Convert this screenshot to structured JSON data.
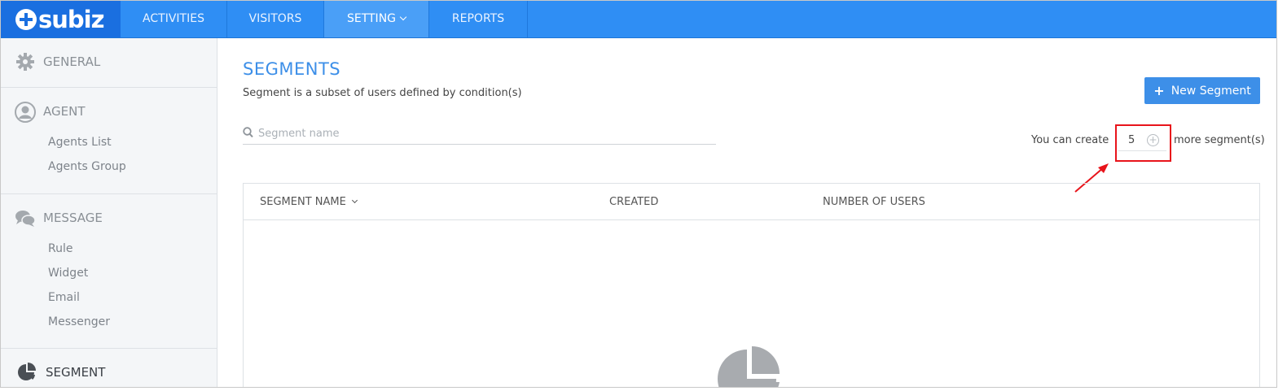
{
  "app": {
    "logo": "subiz"
  },
  "nav": {
    "items": [
      {
        "label": "ACTIVITIES"
      },
      {
        "label": "VISITORS"
      },
      {
        "label": "SETTING"
      },
      {
        "label": "REPORTS"
      }
    ]
  },
  "sidebar": {
    "general": {
      "label": "GENERAL"
    },
    "agent": {
      "label": "AGENT",
      "items": [
        {
          "label": "Agents List"
        },
        {
          "label": "Agents Group"
        }
      ]
    },
    "message": {
      "label": "MESSAGE",
      "items": [
        {
          "label": "Rule"
        },
        {
          "label": "Widget"
        },
        {
          "label": "Email"
        },
        {
          "label": "Messenger"
        }
      ]
    },
    "segment": {
      "label": "SEGMENT"
    }
  },
  "main": {
    "title": "SEGMENTS",
    "subtitle": "Segment is a subset of users defined by condition(s)",
    "new_button": "New Segment",
    "search_placeholder": "Segment name",
    "quota": {
      "prefix": "You can create",
      "value": "5",
      "suffix": "more segment(s)"
    },
    "table": {
      "columns": [
        {
          "label": "SEGMENT NAME"
        },
        {
          "label": "CREATED"
        },
        {
          "label": "NUMBER OF USERS"
        }
      ]
    }
  },
  "colors": {
    "primary": "#2f8ef4",
    "accent": "#3d8fe8",
    "highlight": "#e8141b"
  }
}
